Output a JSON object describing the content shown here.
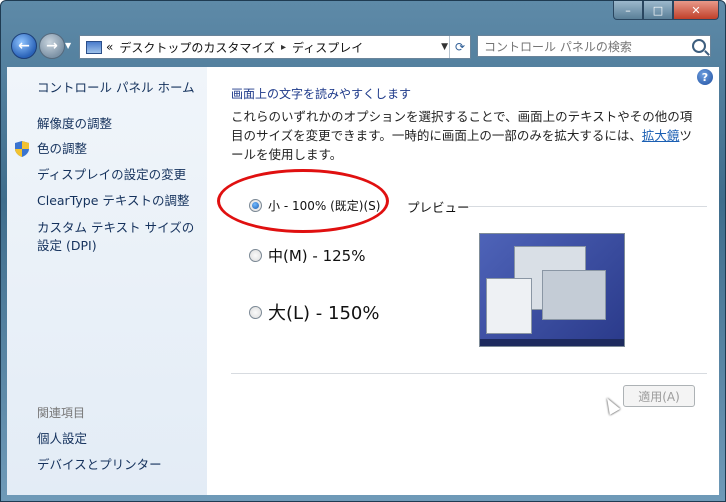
{
  "window": {
    "caption": {
      "minimize": "–",
      "maximize": "□",
      "close": "✕"
    }
  },
  "nav": {
    "back": "←",
    "forward": "→",
    "address": {
      "prefix": "«",
      "crumbs": [
        "デスクトップのカスタマイズ",
        "ディスプレイ"
      ],
      "separator": "▸"
    },
    "search_placeholder": "コントロール パネルの検索"
  },
  "sidebar": {
    "home": "コントロール パネル ホーム",
    "links": [
      "解像度の調整",
      "色の調整",
      "ディスプレイの設定の変更",
      "ClearType テキストの調整",
      "カスタム テキスト サイズの設定 (DPI)"
    ],
    "related_title": "関連項目",
    "related": [
      "個人設定",
      "デバイスとプリンター"
    ]
  },
  "main": {
    "heading": "画面上の文字を読みやすくします",
    "description_before": "これらのいずれかのオプションを選択することで、画面上のテキストやその他の項目のサイズを変更できます。一時的に画面上の一部のみを拡大するには、",
    "description_link": "拡大鏡",
    "description_after": "ツールを使用します。",
    "options": [
      {
        "label": "小 - 100% (既定)(S)",
        "checked": true
      },
      {
        "label": "中(M) - 125%",
        "checked": false
      },
      {
        "label": "大(L) - 150%",
        "checked": false
      }
    ],
    "preview_label": "プレビュー",
    "apply_button": "適用(A)",
    "help": "?"
  }
}
